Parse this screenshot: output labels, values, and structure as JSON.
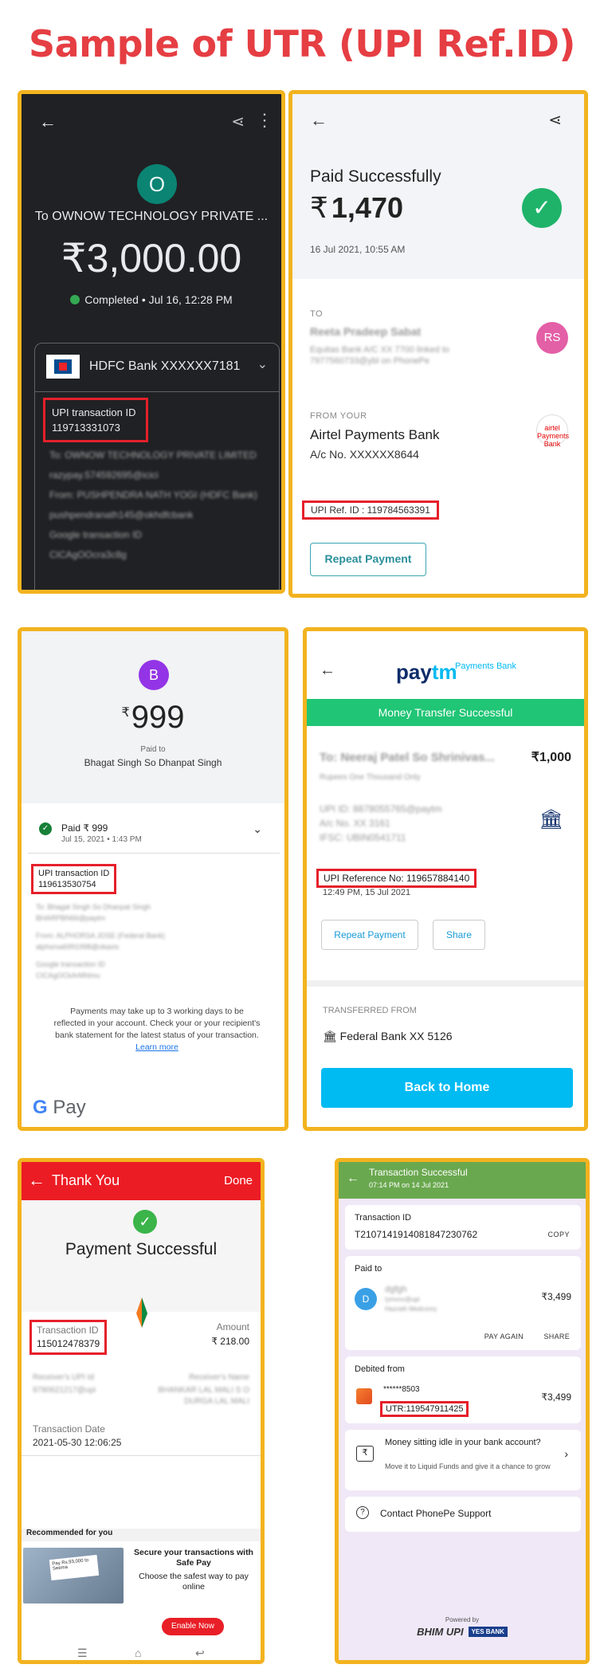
{
  "title": "Sample of UTR (UPI Ref.ID)",
  "colors": {
    "accent": "#e53e43",
    "panel_border": "#f2b31f",
    "highlight": "#e5202a"
  },
  "gpay_dark": {
    "to": "To OWNOW TECHNOLOGY PRIVATE ...",
    "avatar": "O",
    "amount": "₹3,000.00",
    "status": "Completed • Jul 16, 12:28 PM",
    "bank": "HDFC Bank XXXXXX7181",
    "utr_label": "UPI transaction ID",
    "utr_value": "119713331073",
    "blurred": [
      "To: OWNOW TECHNOLOGY PRIVATE LIMITED",
      "razypay.574592695@icici",
      "From: PUSHPENDRA NATH YOGI (HDFC Bank)",
      "pushpendranath145@okhdfcbank",
      "Google transaction ID",
      "CICAgOOcra3c8g"
    ]
  },
  "phonepe_top": {
    "paid_label": "Paid Successfully",
    "currency": "₹",
    "amount": "1,470",
    "date": "16 Jul 2021, 10:55 AM",
    "to_label": "TO",
    "to_name": "Reeta Pradeep Sabat",
    "to_detail": "Equitas Bank A/C XX 7700 linked to 7977560733@ybl on PhonePe",
    "to_avatar": "RS",
    "from_label": "FROM YOUR",
    "from_bank": "Airtel Payments Bank",
    "from_acc": "A/c No. XXXXXX8644",
    "airtel_logo": "airtel Payments Bank",
    "utr": "UPI Ref. ID : 119784563391",
    "repeat": "Repeat Payment"
  },
  "gpay_light": {
    "avatar": "B",
    "currency": "₹",
    "amount": "999",
    "paid_to": "Paid to",
    "name": "Bhagat Singh So Dhanpat Singh",
    "paid_amount": "Paid ₹ 999",
    "date": "Jul 15, 2021 • 1:43 PM",
    "utr_label": "UPI transaction ID",
    "utr_value": "119613530754",
    "blurred": [
      "To: Bhagat Singh So Dhanpat Singh",
      "BHARPBN66@paytm",
      "From: ALPHORSA JOSE (Federal Bank)",
      "alphorsa6991998@okaxis",
      "Google transaction ID",
      "CICAgOCkArMhlmu"
    ],
    "note": "Payments may take up to 3 working days to be reflected in your account. Check your or your recipient's bank statement for the latest status of your transaction.",
    "learn_more": "Learn more",
    "gpay": "Pay"
  },
  "paytm": {
    "brand_pay": "pay",
    "brand_tm": "tm",
    "brand_bank": "Payments Bank",
    "bar": "Money Transfer Successful",
    "to_name": "To: Neeraj Patel So Shrinivas...",
    "amount": "₹1,000",
    "words": "Rupees One Thousand Only",
    "upi_id": "UPI ID: 8878055765@paytm",
    "acc": "A/c No. XX 3161",
    "ifsc": "IFSC: UBIN0541711",
    "utr": "UPI Reference No: 119657884140",
    "time": "12:49 PM, 15 Jul 2021",
    "repeat": "Repeat Payment",
    "share": "Share",
    "transferred_from": "TRANSFERRED FROM",
    "from_bank": "Federal Bank   XX 5126",
    "home": "Back to Home"
  },
  "bhim": {
    "header": "Thank You",
    "done": "Done",
    "success": "Payment Successful",
    "tid_label": "Transaction ID",
    "tid_value": "115012478379",
    "amount_label": "Amount",
    "amount_value": "₹ 218.00",
    "rec_upi_label": "Receiver's UPI Id",
    "rec_upi_value": "9780621217@upi",
    "rec_name_label": "Receiver's Name",
    "rec_name_value": "BHANKAR LAL MALI S O DURGA LAL MALI",
    "date_label": "Transaction Date",
    "date_value": "2021-05-30 12:06:25",
    "recommended": "Recommended for you",
    "promo_img": "Pay Rs.93,000 to Seema",
    "promo_title": "Secure your transactions with Safe Pay",
    "promo_sub": "Choose the safest way to pay online",
    "enable": "Enable Now"
  },
  "phonepe_bottom": {
    "header": "Transaction Successful",
    "header_time": "07:14 PM on 14 Jul 2021",
    "tid_label": "Transaction ID",
    "tid_value": "T2107141914081847230762",
    "copy": "COPY",
    "paid_to": "Paid to",
    "payee_avatar": "D",
    "payee": "dgfgh",
    "payee_detail": "tymvvv@upi",
    "payee_detail2": "Hazrath Medconry",
    "amount": "₹3,499",
    "pay_again": "PAY AGAIN",
    "share": "SHARE",
    "debited": "Debited from",
    "acc": "******8503",
    "utr": "UTR:119547911425",
    "amount2": "₹3,499",
    "idle_title": "Money sitting idle in your bank account?",
    "idle_sub": "Move it to Liquid Funds and give it a chance to grow",
    "rs_icon": "₹",
    "support": "Contact PhonePe Support",
    "powered": "Powered by",
    "logos": "BHIM UPI",
    "yes": "YES BANK"
  }
}
